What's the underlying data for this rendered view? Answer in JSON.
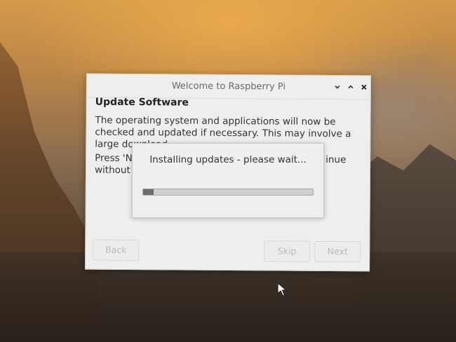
{
  "window": {
    "title": "Welcome to Raspberry Pi",
    "minimize_icon": "chevron-down-icon",
    "maximize_icon": "chevron-up-icon",
    "close_icon": "close-icon"
  },
  "page": {
    "heading": "Update Software",
    "description": "The operating system and applications will now be checked and updated if necessary. This may involve a large download.",
    "instruction_left": "Press 'Nex\nwithout ch",
    "instruction_right": "inue"
  },
  "buttons": {
    "back": "Back",
    "skip": "Skip",
    "next": "Next"
  },
  "progress": {
    "label": "Installing updates - please wait...",
    "fraction": 0.06
  },
  "colors": {
    "dialog_bg": "#eeeeec",
    "progress_fill": "#6b6d70",
    "disabled_text": "#b9b9b7"
  }
}
